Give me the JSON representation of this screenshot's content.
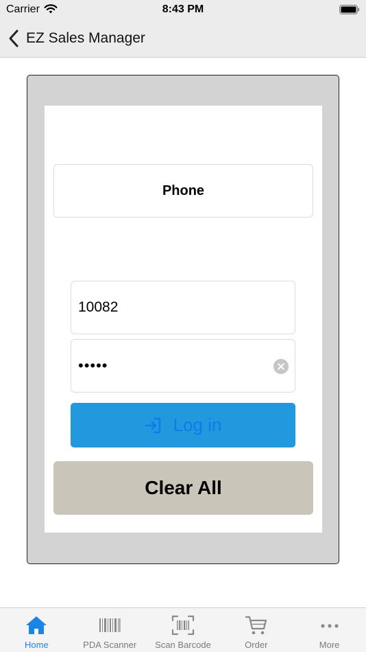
{
  "status_bar": {
    "carrier": "Carrier",
    "time": "8:43 PM"
  },
  "nav": {
    "title": "EZ Sales Manager"
  },
  "login_form": {
    "mode_tab": "Phone",
    "username_value": "10082",
    "password_masked": "•••••",
    "login_label": "Log in",
    "clear_all_label": "Clear All"
  },
  "tab_bar": {
    "items": [
      {
        "label": "Home",
        "icon": "home-icon",
        "active": true
      },
      {
        "label": "PDA Scanner",
        "icon": "barcode-icon",
        "active": false
      },
      {
        "label": "Scan Barcode",
        "icon": "barcode-scan-icon",
        "active": false
      },
      {
        "label": "Order",
        "icon": "cart-icon",
        "active": false
      },
      {
        "label": "More",
        "icon": "more-icon",
        "active": false
      }
    ]
  },
  "colors": {
    "accent": "#1b85e5",
    "login_button": "#2299de",
    "clear_all_button": "#c9c6b9",
    "bar_background": "#ececec"
  }
}
